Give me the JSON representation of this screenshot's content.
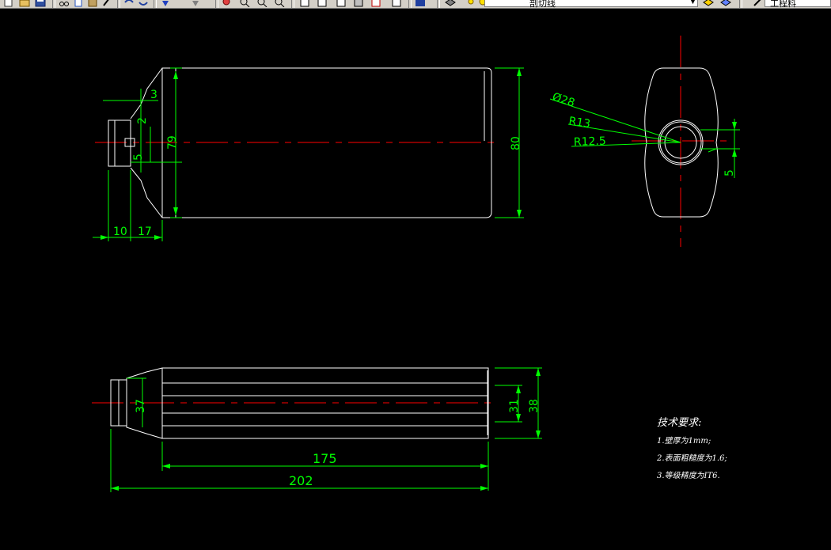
{
  "toolbar": {
    "buttons": [
      "new-icon",
      "open-icon",
      "save-icon",
      "cut-icon",
      "copy-icon",
      "paste-icon",
      "brush-icon",
      "undo-icon",
      "redo-icon",
      "pan-icon",
      "zoom-realtime-icon",
      "zoom-window-icon",
      "zoom-previous-icon",
      "properties-icon",
      "design-center-icon",
      "tool-palettes-icon",
      "sheet-set-icon",
      "markup-icon",
      "calculator-icon",
      "help-icon",
      "layer-manager-icon",
      "lightbulb-icon",
      "sun-icon",
      "freeze-icon",
      "lock-icon",
      "color-icon"
    ],
    "layer_combo": {
      "value": "剖切线"
    },
    "layer_state_combo": {
      "value": "工程料"
    }
  },
  "drawing": {
    "colors": {
      "outline": "#ffffff",
      "dimension": "#00ff00",
      "center": "#ff0000",
      "background": "#000000"
    },
    "front_view_dims": {
      "d3": "3",
      "d2": "2",
      "d79": "79",
      "d80": "80",
      "d10": "10",
      "d17": "17",
      "d5": "5"
    },
    "side_view_dims": {
      "dia28": "Ø28",
      "r13": "R13",
      "r12_5": "R12.5",
      "d5": "5"
    },
    "top_view_dims": {
      "d37": "37",
      "d31": "31",
      "d38": "38",
      "d175": "175",
      "d202": "202"
    }
  },
  "notes": {
    "title": "技术要求:",
    "lines": [
      "1.壁厚为1mm;",
      "2.表面粗糙度为1.6;",
      "3.等级精度为IT6."
    ]
  }
}
